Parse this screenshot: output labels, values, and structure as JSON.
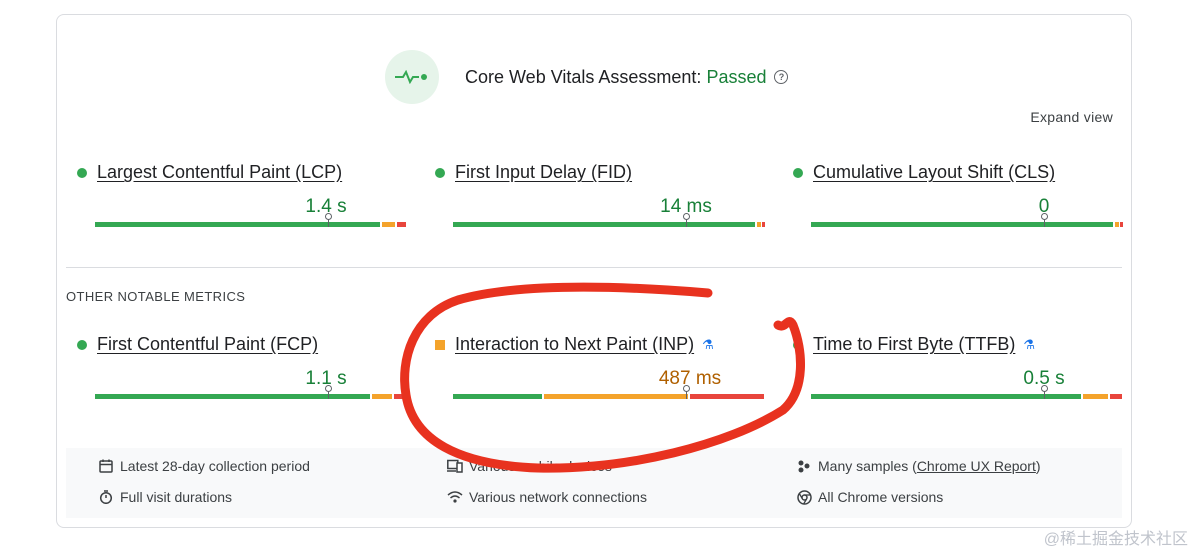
{
  "assessment": {
    "label": "Core Web Vitals Assessment: ",
    "status": "Passed",
    "help": "?"
  },
  "expand_label": "Expand view",
  "core_metrics": [
    {
      "name": "Largest Contentful Paint (LCP)",
      "value": "1.4 s"
    },
    {
      "name": "First Input Delay (FID)",
      "value": "14 ms"
    },
    {
      "name": "Cumulative Layout Shift (CLS)",
      "value": "0"
    }
  ],
  "other_heading": "OTHER NOTABLE METRICS",
  "other_metrics": [
    {
      "name": "First Contentful Paint (FCP)",
      "value": "1.1 s"
    },
    {
      "name": "Interaction to Next Paint (INP)",
      "value": "487 ms"
    },
    {
      "name": "Time to First Byte (TTFB)",
      "value": "0.5 s"
    }
  ],
  "footer": {
    "collection": "Latest 28-day collection period",
    "devices": "Various mobile devices",
    "samples_prefix": "Many samples (",
    "samples_link": "Chrome UX Report",
    "samples_suffix": ")",
    "durations": "Full visit durations",
    "network": "Various network connections",
    "chrome": "All Chrome versions"
  },
  "watermark": "@稀土掘金技术社区",
  "colors": {
    "good": "#34a853",
    "needs_improvement": "#f4a32b",
    "poor": "#e8453c",
    "annotation": "#e8321f"
  }
}
